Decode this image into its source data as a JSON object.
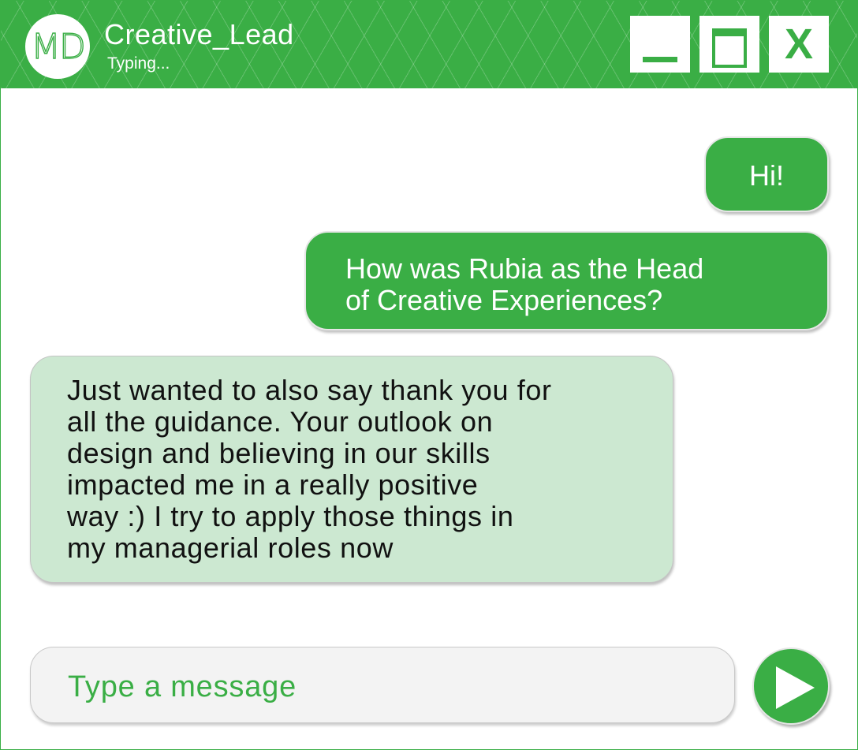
{
  "header": {
    "avatar_initials": "MD",
    "contact_name": "Creative_Lead",
    "status": "Typing..."
  },
  "window_controls": {
    "close_label": "X",
    "minimize_icon": "minimize-icon",
    "maximize_icon": "maximize-icon"
  },
  "messages": [
    {
      "direction": "outgoing",
      "text": "Hi!"
    },
    {
      "direction": "outgoing",
      "text": "How was Rubia as the Head\nof Creative Experiences?"
    },
    {
      "direction": "incoming",
      "text": "Just wanted to also say thank you for\nall the guidance. Your outlook on\ndesign and believing in our skills\nimpacted me in a really positive\nway :) I try to apply those things in\nmy managerial roles now"
    }
  ],
  "composer": {
    "placeholder": "Type a message",
    "value": ""
  },
  "send_icon": "play-triangle-icon",
  "colors": {
    "accent": "#3aae45",
    "incoming_bubble": "#cce8d1",
    "composer_bg": "#f3f3f3"
  }
}
